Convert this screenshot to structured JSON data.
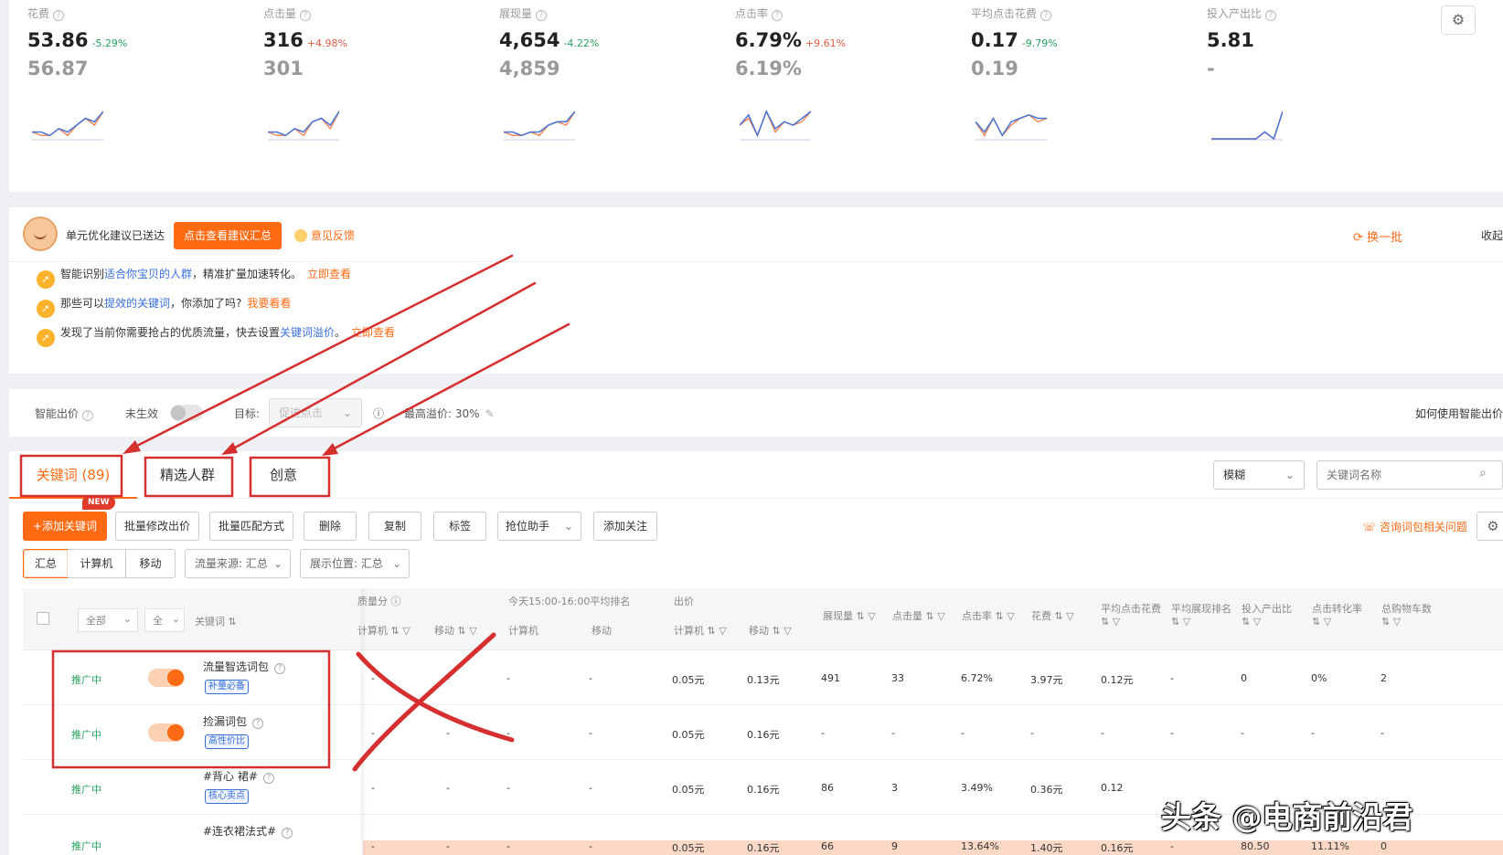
{
  "metrics": [
    {
      "label": "花费",
      "value": "53.86",
      "change": "-5.29%",
      "trend": "down",
      "prev": "56.87",
      "spark": [
        2,
        2,
        1,
        3,
        2,
        4,
        6,
        5,
        8
      ]
    },
    {
      "label": "点击量",
      "value": "316",
      "change": "+4.98%",
      "trend": "up",
      "prev": "301",
      "spark": [
        2,
        2,
        1,
        3,
        2,
        5,
        6,
        4,
        8
      ]
    },
    {
      "label": "展现量",
      "value": "4,654",
      "change": "-4.22%",
      "trend": "down",
      "prev": "4,859",
      "spark": [
        2,
        2,
        1,
        2,
        2,
        4,
        5,
        5,
        8
      ]
    },
    {
      "label": "点击率",
      "value": "6.79%",
      "change": "+9.61%",
      "trend": "up",
      "prev": "6.19%",
      "spark": [
        4,
        7,
        1,
        8,
        3,
        5,
        4,
        6,
        8
      ]
    },
    {
      "label": "平均点击花费",
      "value": "0.17",
      "change": "-9.79%",
      "trend": "down",
      "prev": "0.19",
      "spark": [
        5,
        2,
        6,
        1,
        5,
        6,
        7,
        6,
        6
      ]
    },
    {
      "label": "投入产出比",
      "value": "5.81",
      "change": "",
      "trend": "",
      "prev": "-",
      "spark": [
        0,
        0,
        0,
        0,
        0,
        0,
        2,
        0,
        8
      ]
    }
  ],
  "colors": {
    "accent": "#ff6a13",
    "up": "#e05a46",
    "down": "#27a35e",
    "link": "#3a6fd8",
    "spark_a": "#4a74d6",
    "spark_b": "#f08a5d",
    "annotation": "#d62f2f"
  },
  "suggest": {
    "title": "单元优化建议已送达",
    "view_btn": "点击查看建议汇总",
    "feedback": "意见反馈",
    "refresh": "换一批",
    "collapse": "收起",
    "rows": [
      {
        "pre": "智能识别",
        "blue": "适合你宝贝的人群",
        "post": "，精准扩量加速转化。",
        "link": "立即查看"
      },
      {
        "pre": "那些可以",
        "blue": "提效的关键词",
        "post": "，你添加了吗?",
        "link": "我要看看"
      },
      {
        "pre": "发现了当前你需要抢占的优质流量，快去设置",
        "blue": "关键词溢价",
        "post": "。",
        "link": "立即查看"
      }
    ]
  },
  "smartbid": {
    "label": "智能出价",
    "status": "未生效",
    "target_label": "目标:",
    "target_value": "促进点击",
    "max_premium": "最高溢价: 30%",
    "help": "如何使用智能出价"
  },
  "tabs": [
    {
      "label": "关键词 (89)"
    },
    {
      "label": "精选人群"
    },
    {
      "label": "创意"
    }
  ],
  "filter": {
    "match_mode": "模糊",
    "search_placeholder": "关键词名称"
  },
  "toolbar": {
    "add": "+添加关键词",
    "new_badge": "NEW",
    "batch_bid": "批量修改出价",
    "batch_match": "批量匹配方式",
    "delete": "删除",
    "copy": "复制",
    "tag": "标签",
    "grab": "抢位助手",
    "follow": "添加关注",
    "consult": "咨询词包相关问题"
  },
  "segments": {
    "all": "汇总",
    "pc": "计算机",
    "mobile": "移动",
    "source": "流量来源: 汇总",
    "position": "展示位置: 汇总"
  },
  "table": {
    "head": {
      "status_filter": "全部",
      "all2": "全",
      "keyword": "关键词",
      "quality": "质量分",
      "rank_group": "今天15:00-16:00平均排名",
      "bid_group": "出价",
      "pc": "计算机",
      "mobile": "移动",
      "impressions": "展现量",
      "clicks": "点击量",
      "ctr": "点击率",
      "cost": "花费",
      "cpc": "平均点击花费",
      "avg_rank": "平均展现排名",
      "roi": "投入产出比",
      "cvr": "点击转化率",
      "cart": "总购物车数"
    },
    "rows": [
      {
        "status": "推广中",
        "name": "流量智选词包",
        "tag": "补量必备",
        "q_pc": "-",
        "q_m": "-",
        "r_pc": "-",
        "r_m": "-",
        "b_pc": "0.05元",
        "b_m": "0.13元",
        "imp": "491",
        "clk": "33",
        "ctr": "6.72%",
        "cost": "3.97元",
        "cpc": "0.12元",
        "arank": "-",
        "roi": "0",
        "cvr": "0%",
        "cart": "2"
      },
      {
        "status": "推广中",
        "name": "捡漏词包",
        "tag": "高性价比",
        "q_pc": "-",
        "q_m": "-",
        "r_pc": "-",
        "r_m": "-",
        "b_pc": "0.05元",
        "b_m": "0.16元",
        "imp": "-",
        "clk": "-",
        "ctr": "-",
        "cost": "-",
        "cpc": "-",
        "arank": "-",
        "roi": "-",
        "cvr": "-",
        "cart": "-"
      },
      {
        "status": "推广中",
        "name": "#背心 裙#",
        "tag": "核心卖点",
        "q_pc": "-",
        "q_m": "-",
        "r_pc": "-",
        "r_m": "-",
        "b_pc": "0.05元",
        "b_m": "0.16元",
        "imp": "86",
        "clk": "3",
        "ctr": "3.49%",
        "cost": "0.36元",
        "cpc": "0.12",
        "arank": "",
        "roi": "",
        "cvr": "",
        "cart": ""
      },
      {
        "status": "推广中",
        "name": "#连衣裙法式#",
        "tag": "",
        "q_pc": "-",
        "q_m": "-",
        "r_pc": "-",
        "r_m": "-",
        "b_pc": "0.05元",
        "b_m": "0.16元",
        "imp": "66",
        "clk": "9",
        "ctr": "13.64%",
        "cost": "1.40元",
        "cpc": "0.16元",
        "arank": "-",
        "roi": "80.50",
        "cvr": "11.11%",
        "cart": "0"
      }
    ]
  },
  "watermark": "头条 @电商前沿君"
}
